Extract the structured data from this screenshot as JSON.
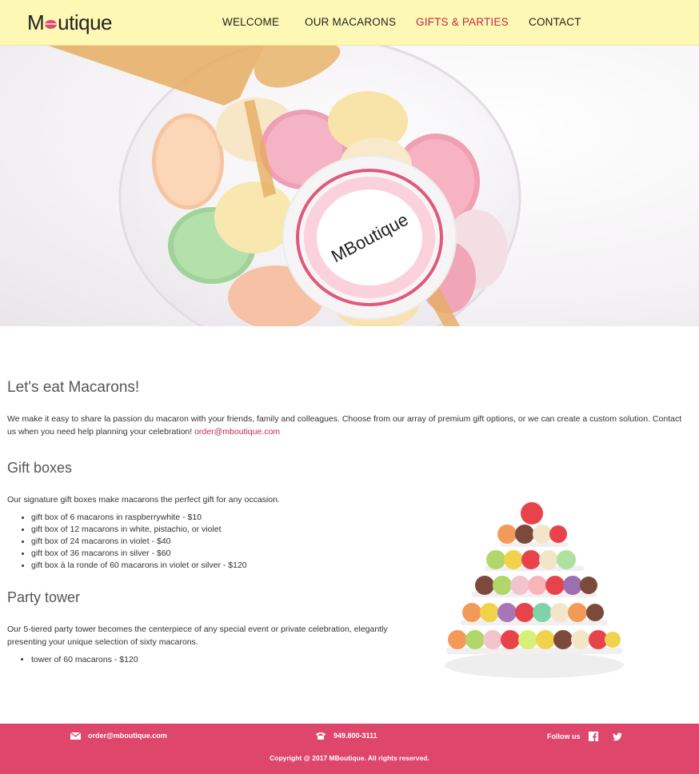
{
  "header": {
    "logo": "MBoutique",
    "nav": [
      {
        "label": "WELCOME",
        "active": false
      },
      {
        "label": "OUR MACARONS",
        "active": false
      },
      {
        "label": "GIFTS & PARTIES",
        "active": true
      },
      {
        "label": "CONTACT",
        "active": false
      }
    ]
  },
  "hero": {
    "label_logo": "MBoutique"
  },
  "main": {
    "title": "Let's eat Macarons!",
    "intro_text": "We make it easy to share la passion du macaron with your friends, family and colleagues. Choose from our array of premium gift options, or we can create a custom solution. Contact us when you need help planning your celebration! ",
    "intro_email": "order@mboutique.com",
    "gift_title": "Gift boxes",
    "gift_desc": "Our signature gift boxes make macarons the perfect gift for any occasion.",
    "gift_items": [
      "gift box of 6 macarons in raspberrywhite - $10",
      "gift box of 12 macarons in white, pistachio, or violet",
      "gift box of 24 macarons in violet - $40",
      "gift box of 36 macarons in silver - $60",
      "gift box à la ronde of 60 macarons in violet or silver - $120"
    ],
    "party_title": "Party tower",
    "party_desc": "Our 5-tiered party tower becomes the centerpiece of any special event or private celebration, elegantly presenting your unique selection of sixty macarons.",
    "party_items": [
      "tower of 60 macarons - $120"
    ]
  },
  "footer": {
    "email": "order@mboutique.com",
    "phone": "949.800-3111",
    "follow_label": "Follow us",
    "copyright": "Copyright @ 2017 MBoutique. All rights reserved."
  },
  "colors": {
    "header_bg": "#fdf8b4",
    "accent": "#c0294a",
    "footer_bg": "#df466c"
  }
}
